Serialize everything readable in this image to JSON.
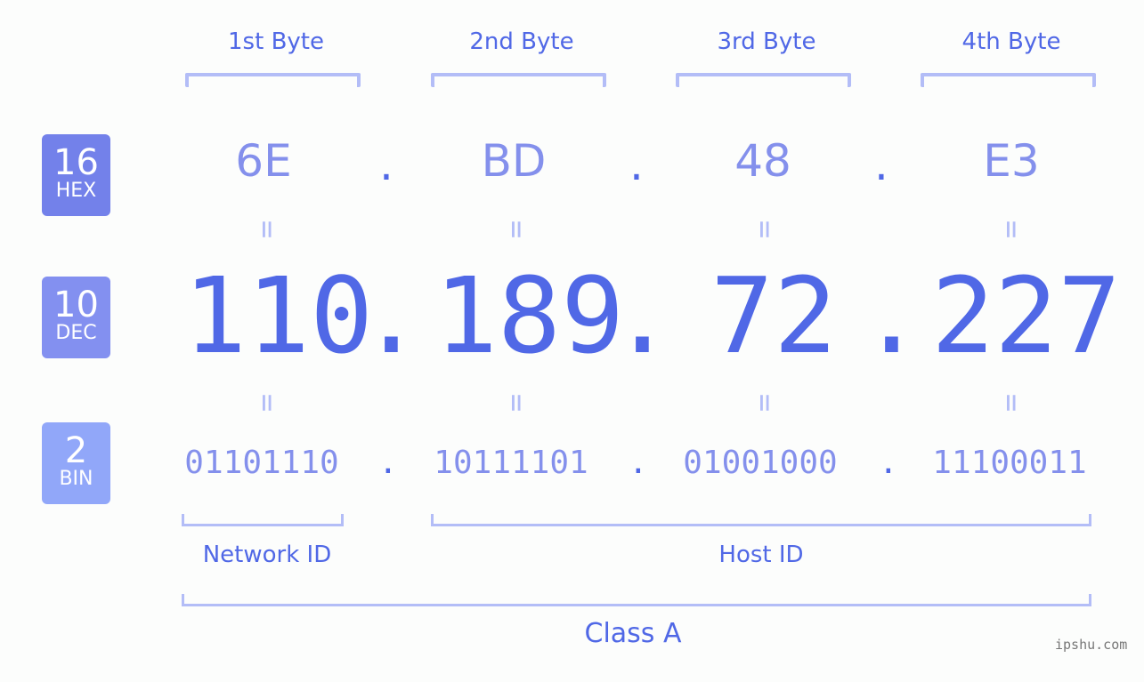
{
  "diagram": {
    "ip_address": "110.189.72.227",
    "byte_headers": [
      "1st Byte",
      "2nd Byte",
      "3rd Byte",
      "4th Byte"
    ],
    "rows": {
      "hex": {
        "base": "16",
        "name": "HEX",
        "values": [
          "6E",
          "BD",
          "48",
          "E3"
        ],
        "color": "#7381ea"
      },
      "dec": {
        "base": "10",
        "name": "DEC",
        "values": [
          "110",
          "189",
          "72",
          "227"
        ],
        "color": "#8390f0"
      },
      "bin": {
        "base": "2",
        "name": "BIN",
        "values": [
          "01101110",
          "10111101",
          "01001000",
          "11100011"
        ],
        "color": "#91a7f9"
      }
    },
    "separator": ".",
    "equals_sign": "=",
    "network_id_label": "Network ID",
    "host_id_label": "Host ID",
    "class_label": "Class A",
    "watermark": "ipshu.com"
  }
}
